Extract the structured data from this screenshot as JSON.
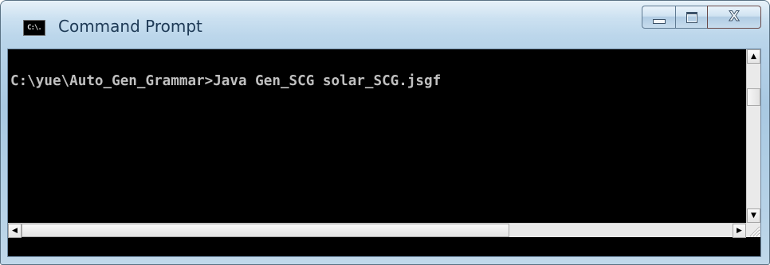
{
  "window": {
    "title": "Command Prompt",
    "app_icon_label": "C:\\."
  },
  "caption": {
    "minimize_icon": "minimize-icon",
    "maximize_icon": "maximize-icon",
    "close_glyph": "X"
  },
  "console": {
    "line1": "C:\\yue\\Auto_Gen_Grammar>Java Gen_SCG solar_SCG.jsgf",
    "background": "#000000",
    "foreground": "#c0c0c0"
  },
  "scrollbars": {
    "up_arrow": "▲",
    "down_arrow": "▼",
    "left_arrow": "◀",
    "right_arrow": "▶"
  }
}
